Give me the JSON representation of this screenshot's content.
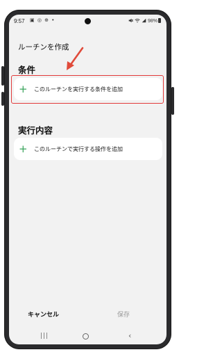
{
  "status_bar": {
    "time": "9:57",
    "left_icons": "▣ ◎ ⊕ •",
    "right_text": "98%"
  },
  "page": {
    "title": "ルーチンを作成"
  },
  "conditions": {
    "heading": "条件",
    "add_label": "このルーチンを実行する条件を追加"
  },
  "actions": {
    "heading": "実行内容",
    "add_label": "このルーチンで実行する操作を追加"
  },
  "footer": {
    "cancel_label": "キャンセル",
    "save_label": "保存"
  },
  "colors": {
    "accent_plus": "#3aa45c",
    "annotation_red": "#e23b3b"
  }
}
